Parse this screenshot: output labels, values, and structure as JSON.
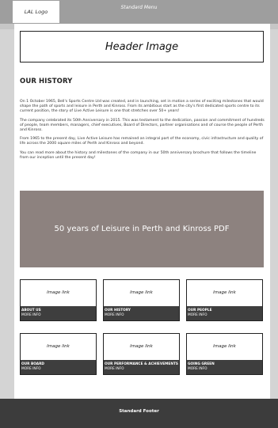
{
  "nav": {
    "logo": "LAL Logo",
    "menu": "Standard Menu"
  },
  "header": {
    "image_label": "Header Image"
  },
  "history": {
    "title": "OUR HISTORY",
    "paragraphs": [
      "On 1 October 1965, Bell's Sports Centre Ltd was created, and in launching, set in motion a series of exciting milestones that would shape the path of sports and leisure in Perth and Kinross. From its ambitious start as the city's first dedicated sports centre to its current position, the story of Live Active Leisure is one that stretches over 50+ years!",
      "The company celebrated its 50th Anniversary in 2015. This was testament to the dedication, passion and commitment of hundreds of people, team members, managers, chief executives, Board of Directors, partner organisations and of course the people of Perth and Kinross.",
      "From 1965 to the present day, Live Active Leisure has remained an integral part of the economy, civic infrastructure and quality of life across the 2000 square miles of Perth and Kinross and beyond.",
      "You can read more about the history and milestones of the company in our 50th anniversary brochure that follows the timeline from our inception until the present day!"
    ]
  },
  "pdf": {
    "label": "50 years of Leisure in Perth and Kinross PDF"
  },
  "tiles": [
    {
      "image": "Image link",
      "name": "ABOUT US",
      "more": "MORE INFO"
    },
    {
      "image": "Image link",
      "name": "OUR HISTORY",
      "more": "MORE INFO"
    },
    {
      "image": "Image link",
      "name": "OUR PEOPLE",
      "more": "MORE INFO"
    },
    {
      "image": "Image link",
      "name": "OUR BOARD",
      "more": "MORE INFO"
    },
    {
      "image": "Image link",
      "name": "OUR PERFORMANCE & ACHIEVEMENTS",
      "more": "MORE INFO"
    },
    {
      "image": "Image link",
      "name": "GOING GREEN",
      "more": "MORE INFO"
    }
  ],
  "footer": {
    "label": "Standard Footer"
  },
  "colors": {
    "nav_bar": "#9e9e9e",
    "pdf_box": "#8d827f",
    "tile_bar": "#3e3e3e",
    "footer": "#3c3c3c"
  }
}
